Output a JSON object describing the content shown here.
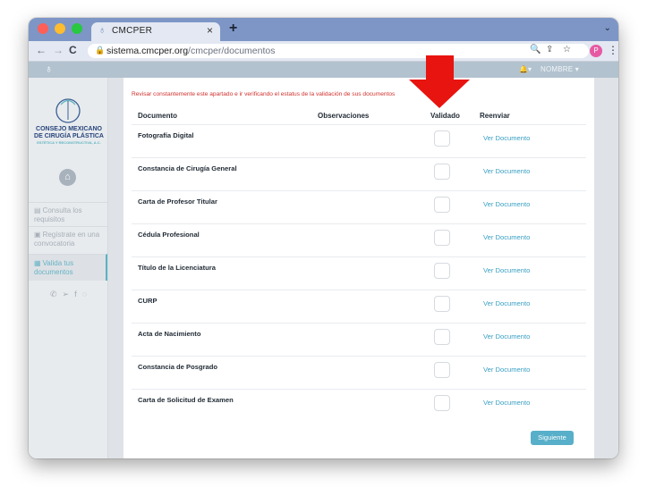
{
  "browser": {
    "tab_title": "CMCPER",
    "tab_close": "×",
    "new_tab": "+",
    "url_host": "sistema.cmcper.org",
    "url_path": "/cmcper/documentos"
  },
  "profile": {
    "initial": "P"
  },
  "topnav": {
    "bell": "🔔▾",
    "user": "NOMBRE ▾"
  },
  "sidebar": {
    "org_name_line1": "CONSEJO MEXICANO",
    "org_name_line2": "DE CIRUGÍA PLÁSTICA",
    "org_sub": "ESTÉTICA Y RECONSTRUCTIVA, A.C.",
    "items": [
      {
        "label": "Consulta los requisitos"
      },
      {
        "label": "Regístrate en una convocatoria"
      },
      {
        "label": "Valida tus documentos"
      }
    ]
  },
  "content": {
    "notice": "Revisar constantemente este apartado e ir verificando el estatus de la validación de sus documentos",
    "headers": {
      "document": "Documento",
      "observations": "Observaciones",
      "validated": "Validado",
      "resend": "Reenviar"
    },
    "rows": [
      {
        "name": "Fotografía Digital",
        "link": "Ver Documento"
      },
      {
        "name": "Constancia de Cirugía General",
        "link": "Ver Documento"
      },
      {
        "name": "Carta de Profesor Titular",
        "link": "Ver Documento"
      },
      {
        "name": "Cédula Profesional",
        "link": "Ver Documento"
      },
      {
        "name": "Título de la Licenciatura",
        "link": "Ver Documento"
      },
      {
        "name": "CURP",
        "link": "Ver Documento"
      },
      {
        "name": "Acta de Nacimiento",
        "link": "Ver Documento"
      },
      {
        "name": "Constancia de Posgrado",
        "link": "Ver Documento"
      },
      {
        "name": "Carta de Solicitud de Examen",
        "link": "Ver Documento"
      }
    ],
    "next_label": "Siguiente"
  },
  "colors": {
    "accent": "#57afc9",
    "notice": "#d0312d",
    "arrow": "#e8140f",
    "topbar": "#b2c2cf"
  }
}
